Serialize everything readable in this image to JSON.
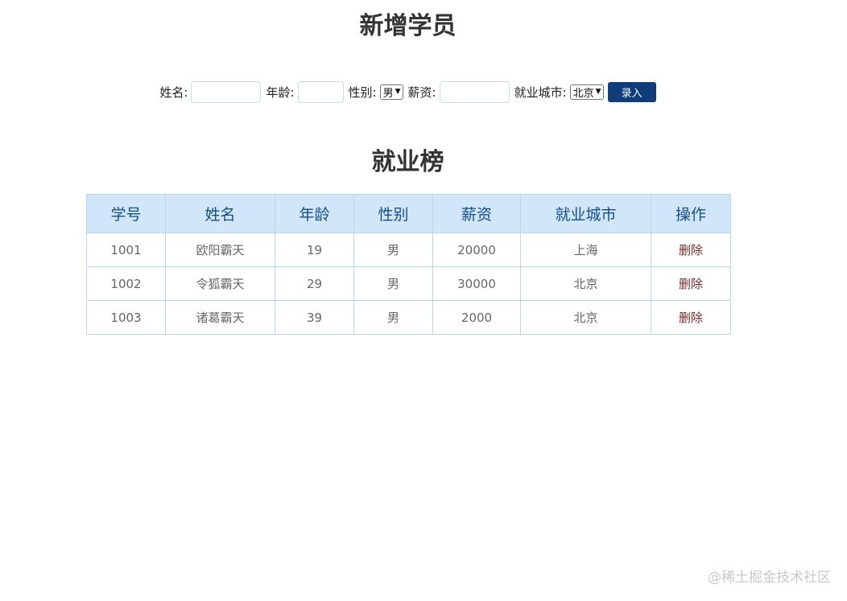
{
  "add_section": {
    "title": "新增学员",
    "name_label": "姓名:",
    "age_label": "年龄:",
    "gender_label": "性别:",
    "gender_selected": "男",
    "salary_label": "薪资:",
    "city_label": "就业城市:",
    "city_selected": "北京",
    "submit_label": "录入"
  },
  "rank_section": {
    "title": "就业榜"
  },
  "table": {
    "headers": [
      "学号",
      "姓名",
      "年龄",
      "性别",
      "薪资",
      "就业城市",
      "操作"
    ],
    "rows": [
      {
        "id": "1001",
        "name": "欧阳霸天",
        "age": "19",
        "gender": "男",
        "salary": "20000",
        "city": "上海",
        "action": "删除"
      },
      {
        "id": "1002",
        "name": "令狐霸天",
        "age": "29",
        "gender": "男",
        "salary": "30000",
        "city": "北京",
        "action": "删除"
      },
      {
        "id": "1003",
        "name": "诸葛霸天",
        "age": "39",
        "gender": "男",
        "salary": "2000",
        "city": "北京",
        "action": "删除"
      }
    ]
  },
  "watermark": "@稀土掘金技术社区",
  "colors": {
    "header_bg": "#d2e6fa",
    "header_text": "#124f86",
    "button_bg": "#0e3d7a",
    "border": "#b8d6ec"
  }
}
